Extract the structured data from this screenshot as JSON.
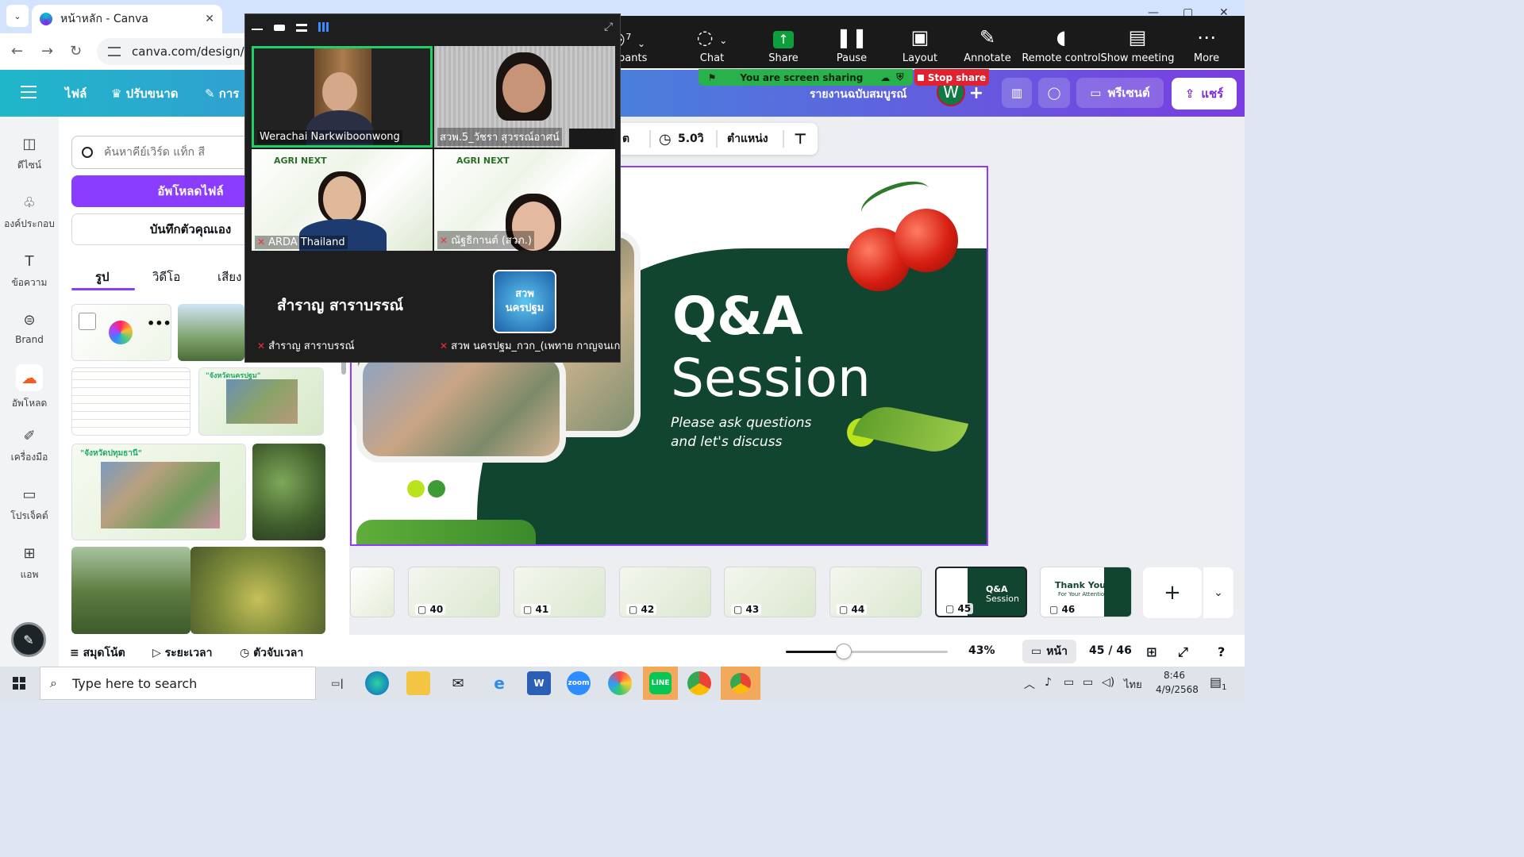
{
  "browser": {
    "active_tab_title": "หน้าหลัก - Canva",
    "url": "canva.com/design/DAG",
    "close_glyph": "✕"
  },
  "canva": {
    "menu": {
      "file": "ไฟล์",
      "resize": "ปรับขนาด",
      "edit": "การ"
    },
    "header_right": {
      "doc_title": "รายงานฉบับสมบูรณ์",
      "avatar_letter": "W",
      "present": "พรีเซนต์",
      "share": "แชร์"
    },
    "left_nav": [
      {
        "label": "ดีไซน์",
        "icon": "design-icon"
      },
      {
        "label": "องค์ประกอบ",
        "icon": "elements-icon"
      },
      {
        "label": "ข้อความ",
        "icon": "text-icon"
      },
      {
        "label": "Brand",
        "icon": "brand-icon"
      },
      {
        "label": "อัพโหลด",
        "icon": "upload-icon"
      },
      {
        "label": "เครื่องมือ",
        "icon": "tools-icon"
      },
      {
        "label": "โปรเจ็คต์",
        "icon": "projects-icon"
      },
      {
        "label": "แอพ",
        "icon": "apps-icon"
      }
    ],
    "panel": {
      "search_placeholder": "ค้นหาคีย์เวิร์ด แท็ก สี",
      "upload_button": "อัพโหลดไฟล์",
      "record_button": "บันทึกตัวคุณเอง",
      "tabs": [
        "รูป",
        "วิดีโอ",
        "เสียง"
      ],
      "thumb_captions": [
        "\"จังหวัดนครปฐม\"",
        "\"จังหวัดปทุมธานี\""
      ]
    },
    "floating_toolbar": {
      "partial_label": "ต",
      "duration": "5.0วิ",
      "position": "ตำแหน่ง"
    },
    "slide": {
      "title_line1": "Q&A",
      "title_line2": "Session",
      "subtitle_line1": "Please ask questions",
      "subtitle_line2": "and let's discuss",
      "colors": {
        "dark_green": "#11452f",
        "lime": "#b8e31d",
        "tomato": "#d71f12"
      }
    },
    "filmstrip": {
      "pages": [
        {
          "num": "40"
        },
        {
          "num": "41"
        },
        {
          "num": "42"
        },
        {
          "num": "43"
        },
        {
          "num": "44"
        },
        {
          "num": "45",
          "label_a": "Q&A",
          "label_b": "Session",
          "active": true
        },
        {
          "num": "46",
          "label_a": "Thank You",
          "label_b": "For Your Attention"
        }
      ]
    },
    "bottom": {
      "notes": "สมุดโน้ต",
      "timeline": "ระยะเวลา",
      "timer": "ตัวจับเวลา",
      "zoom_percent": "43%",
      "zoom_level": 0.36,
      "page_label": "หน้า",
      "page_counter": "45 / 46"
    }
  },
  "zoom": {
    "toolbar": [
      {
        "label": "icipants",
        "icon": "participants-icon",
        "count": "7"
      },
      {
        "label": "Chat",
        "icon": "chat-icon"
      },
      {
        "label": "Share",
        "icon": "share-screen-icon"
      },
      {
        "label": "Pause",
        "icon": "pause-icon"
      },
      {
        "label": "Layout",
        "icon": "layout-icon"
      },
      {
        "label": "Annotate",
        "icon": "annotate-icon"
      },
      {
        "label": "Remote control",
        "icon": "remote-control-icon"
      },
      {
        "label": "Show meeting",
        "icon": "show-meeting-icon"
      },
      {
        "label": "More",
        "icon": "more-icon"
      }
    ],
    "sharing_text": "You are screen sharing",
    "stop_share": "Stop share",
    "tiles": [
      {
        "name": "Werachai Narkwiboonwong",
        "speaking": true
      },
      {
        "name": "สวพ.5_วัชรา สุวรรณ์อาศน์"
      },
      {
        "name": "ARDA Thailand",
        "muted": true
      },
      {
        "name": "ณัฐธิกานต์ (สวภ.)",
        "muted": true
      },
      {
        "name": "สำราญ  สาราบรรณ์",
        "muted": true,
        "display_name": "สำราญ  สาราบรรณ์"
      },
      {
        "name": "สวพ นครปฐม_กวก_(เพทาย กาญจนเกษ...",
        "muted": true,
        "logo_text": "สวพ นครปฐม"
      }
    ]
  },
  "taskbar": {
    "search_placeholder": "Type here to search",
    "apps": [
      "task-view-icon",
      "edge-icon",
      "file-explorer-icon",
      "mail-icon",
      "ie-icon",
      "word-icon",
      "zoom-icon",
      "photos-icon",
      "line-icon",
      "chrome-icon",
      "chrome-alt-icon"
    ],
    "lang": "ไทย",
    "time": "8:46",
    "date": "4/9/2568",
    "notification_count": "1"
  }
}
